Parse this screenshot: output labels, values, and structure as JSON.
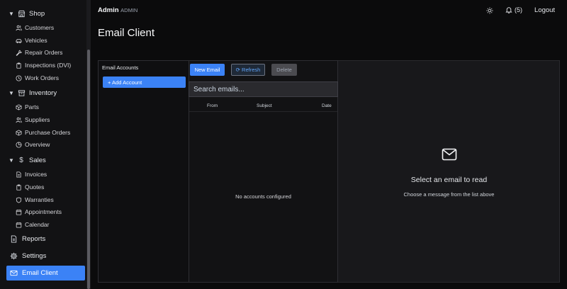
{
  "sidebar": {
    "shop": {
      "label": "Shop",
      "items": [
        "Customers",
        "Vehicles",
        "Repair Orders",
        "Inspections (DVI)",
        "Work Orders"
      ]
    },
    "inventory": {
      "label": "Inventory",
      "items": [
        "Parts",
        "Suppliers",
        "Purchase Orders",
        "Overview"
      ]
    },
    "sales": {
      "label": "Sales",
      "items": [
        "Invoices",
        "Quotes",
        "Warranties",
        "Appointments",
        "Calendar"
      ]
    },
    "reports": "Reports",
    "settings": "Settings",
    "email_client": "Email Client"
  },
  "topbar": {
    "user": "Admin",
    "role": "· ADMIN",
    "notifications": "(5)",
    "logout": "Logout"
  },
  "page": {
    "title": "Email Client"
  },
  "accounts": {
    "title": "Email Accounts",
    "add_button": "+ Add Account"
  },
  "toolbar": {
    "new_email": "New Email",
    "refresh": "⟳ Refresh",
    "delete": "Delete"
  },
  "list": {
    "search_placeholder": "Search emails...",
    "columns": {
      "from": "From",
      "subject": "Subject",
      "date": "Date"
    },
    "empty_message": "No accounts configured"
  },
  "reader": {
    "title": "Select an email to read",
    "subtitle": "Choose a message from the list above"
  },
  "colors": {
    "accent": "#3b82f6",
    "background": "#0b0b0c",
    "panel": "#18181b"
  }
}
